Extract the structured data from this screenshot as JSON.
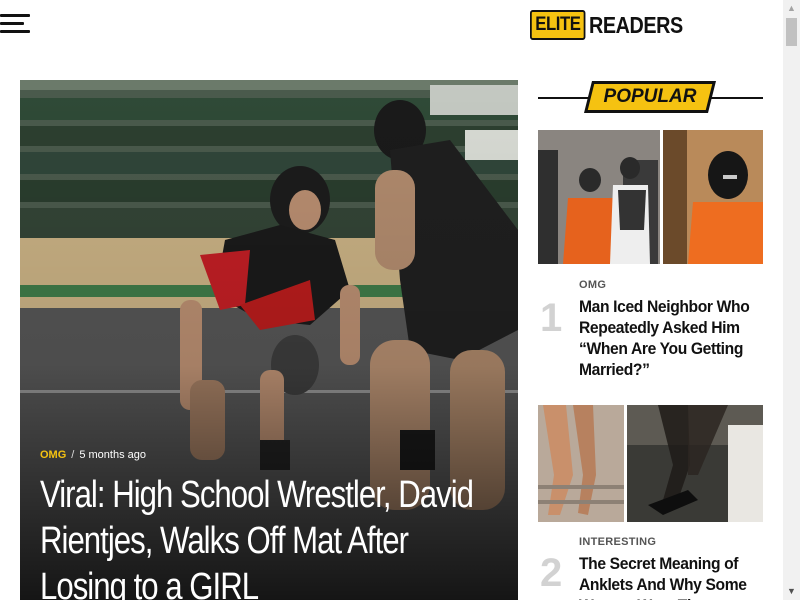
{
  "header": {
    "menu_icon": "hamburger-menu-icon",
    "logo": {
      "part1": "ELITE",
      "part2": "READERS"
    }
  },
  "hero": {
    "category": "OMG",
    "separator": "/",
    "time": "5 months ago",
    "title": "Viral: High School Wrestler, David Rientjes, Walks Off Mat After Losing to a GIRL"
  },
  "sidebar": {
    "heading": "POPULAR",
    "items": [
      {
        "number": "1",
        "category": "OMG",
        "title": "Man Iced Neighbor Who Repeatedly Asked Him “When Are You Getting Married?”"
      },
      {
        "number": "2",
        "category": "INTERESTING",
        "title": "The Secret Meaning of Anklets And Why Some Women Wear Them"
      }
    ]
  },
  "colors": {
    "accent": "#f5c211",
    "text": "#111111",
    "muted": "#d2d2d2"
  },
  "scrollbar": {
    "up_icon": "scroll-up-arrow-icon",
    "down_icon": "scroll-down-arrow-icon"
  }
}
